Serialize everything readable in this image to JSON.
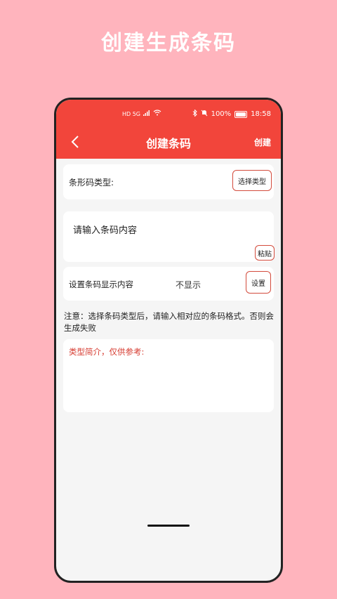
{
  "promo": {
    "title": "创建生成条码"
  },
  "status_bar": {
    "left_icons": "HD 5G",
    "battery": "100%",
    "time": "18:58"
  },
  "nav": {
    "title": "创建条码",
    "action_label": "创建"
  },
  "barcode_type": {
    "label": "条形码类型:",
    "select_button": "选择类型"
  },
  "content_input": {
    "placeholder": "请输入条码内容",
    "paste_button": "粘贴"
  },
  "display_setting": {
    "label": "设置条码显示内容",
    "value": "不显示",
    "set_button": "设置"
  },
  "notice": "注意：选择条码类型后，请输入相对应的条码格式。否则会生成失败",
  "intro": {
    "title": "类型简介，仅供参考:"
  },
  "colors": {
    "accent": "#f2453b",
    "background": "#ffb4bd",
    "button_border": "#d34b3c"
  }
}
